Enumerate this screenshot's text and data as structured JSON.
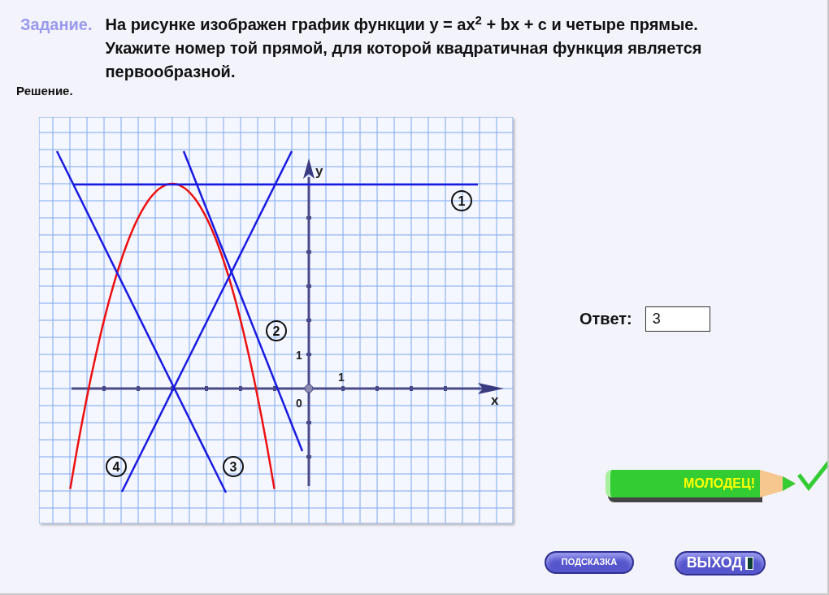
{
  "task": {
    "label": "Задание.",
    "text": "На рисунке изображен график функции y = ax$^{2}$ + bx + c и четыре прямые. Укажите номер той прямой, для которой квадратичная функция является первообразной."
  },
  "solution_label": "Решение.",
  "graph": {
    "x_axis_label": "x",
    "y_axis_label": "y",
    "origin_label": "0",
    "x_unit_label": "1",
    "y_unit_label": "1",
    "lines": [
      {
        "label": "1"
      },
      {
        "label": "2"
      },
      {
        "label": "3"
      },
      {
        "label": "4"
      }
    ]
  },
  "answer": {
    "label": "Ответ:",
    "value": "3"
  },
  "feedback": "МОЛОДЕЦ!",
  "buttons": [
    {
      "label": "ПОДСКАЗКА"
    },
    {
      "label": "ВЫХОД"
    }
  ]
}
